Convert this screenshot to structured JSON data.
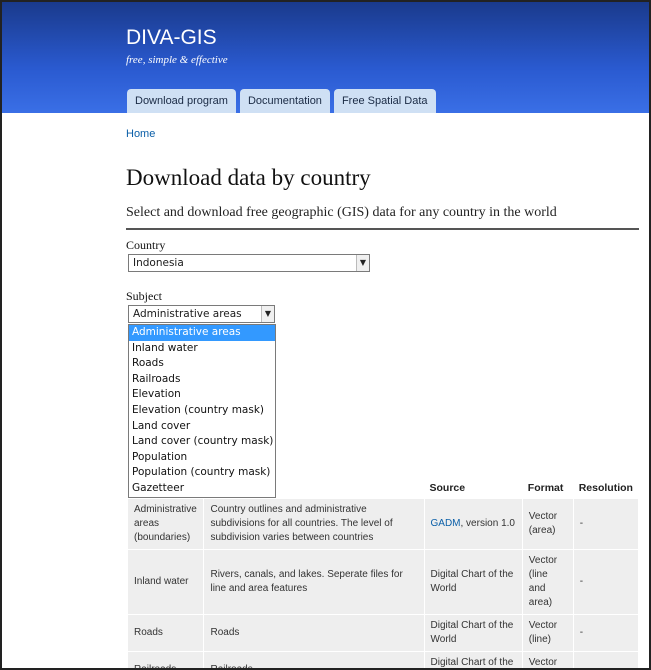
{
  "site": {
    "title": "DIVA-GIS",
    "slogan": "free, simple & effective"
  },
  "tabs": [
    {
      "label": "Download program"
    },
    {
      "label": "Documentation"
    },
    {
      "label": "Free Spatial Data"
    }
  ],
  "breadcrumb": "Home",
  "page": {
    "title": "Download data by country",
    "subtitle": "Select and download free geographic (GIS) data for any country in the world"
  },
  "form": {
    "country_label": "Country",
    "country_value": "Indonesia",
    "subject_label": "Subject",
    "subject_value": "Administrative areas",
    "subject_options": [
      "Administrative areas",
      "Inland water",
      "Roads",
      "Railroads",
      "Elevation",
      "Elevation (country mask)",
      "Land cover",
      "Land cover (country mask)",
      "Population",
      "Population (country mask)",
      "Gazetteer"
    ]
  },
  "table": {
    "headers": [
      "",
      "",
      "Source",
      "Format",
      "Resolution"
    ],
    "rows": [
      {
        "subject": "Administrative areas (boundaries)",
        "description": "Country outlines and administrative subdivisions for all countries. The level of subdivision varies between countries",
        "source_link": "GADM",
        "source_rest": ", version 1.0",
        "format": "Vector (area)",
        "resolution": "-"
      },
      {
        "subject": "Inland water",
        "description": "Rivers, canals, and lakes. Seperate files for line and area features",
        "source_link": "",
        "source_rest": "Digital Chart of the World",
        "format": "Vector (line and area)",
        "resolution": "-"
      },
      {
        "subject": "Roads",
        "description": "Roads",
        "source_link": "",
        "source_rest": "Digital Chart of the World",
        "format": "Vector (line)",
        "resolution": "-"
      },
      {
        "subject": "Railroads",
        "description": "Railroads",
        "source_link": "",
        "source_rest": "Digital Chart of the World",
        "format": "Vector (line)",
        "resolution": "-"
      }
    ]
  },
  "icons": {
    "dropdown": "chevron-down-icon"
  },
  "colors": {
    "header_top": "#1a3a8c",
    "header_bottom": "#3a6fe6",
    "tab_bg": "#cfe0f4",
    "selected_option": "#3399ff",
    "link": "#0b5fa8"
  }
}
